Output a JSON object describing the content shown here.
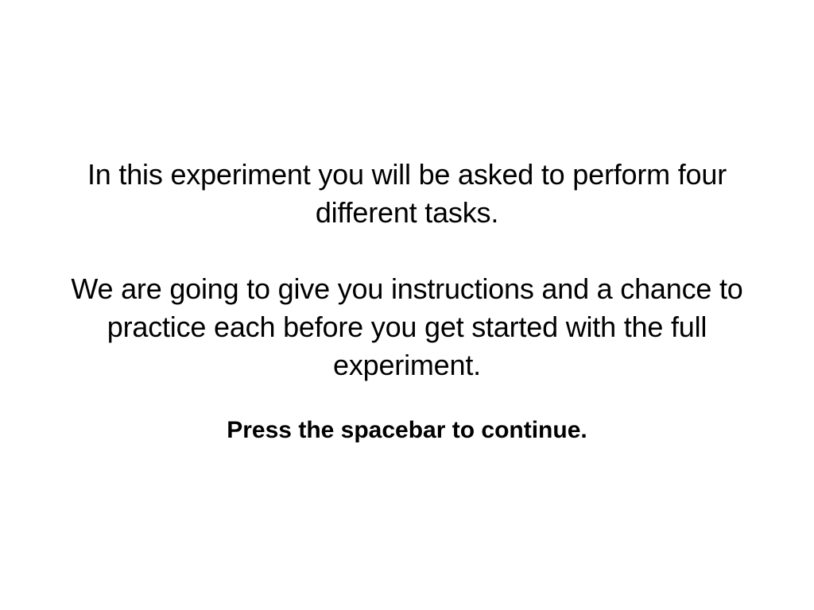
{
  "instructions": {
    "intro": "In this experiment you will be asked to perform four different tasks.",
    "details": "We are going to give you instructions and a chance to practice each before you get started with the full experiment.",
    "continue_prompt": "Press the spacebar to continue."
  },
  "colors": {
    "background": "#ffffff",
    "text": "#000000"
  }
}
